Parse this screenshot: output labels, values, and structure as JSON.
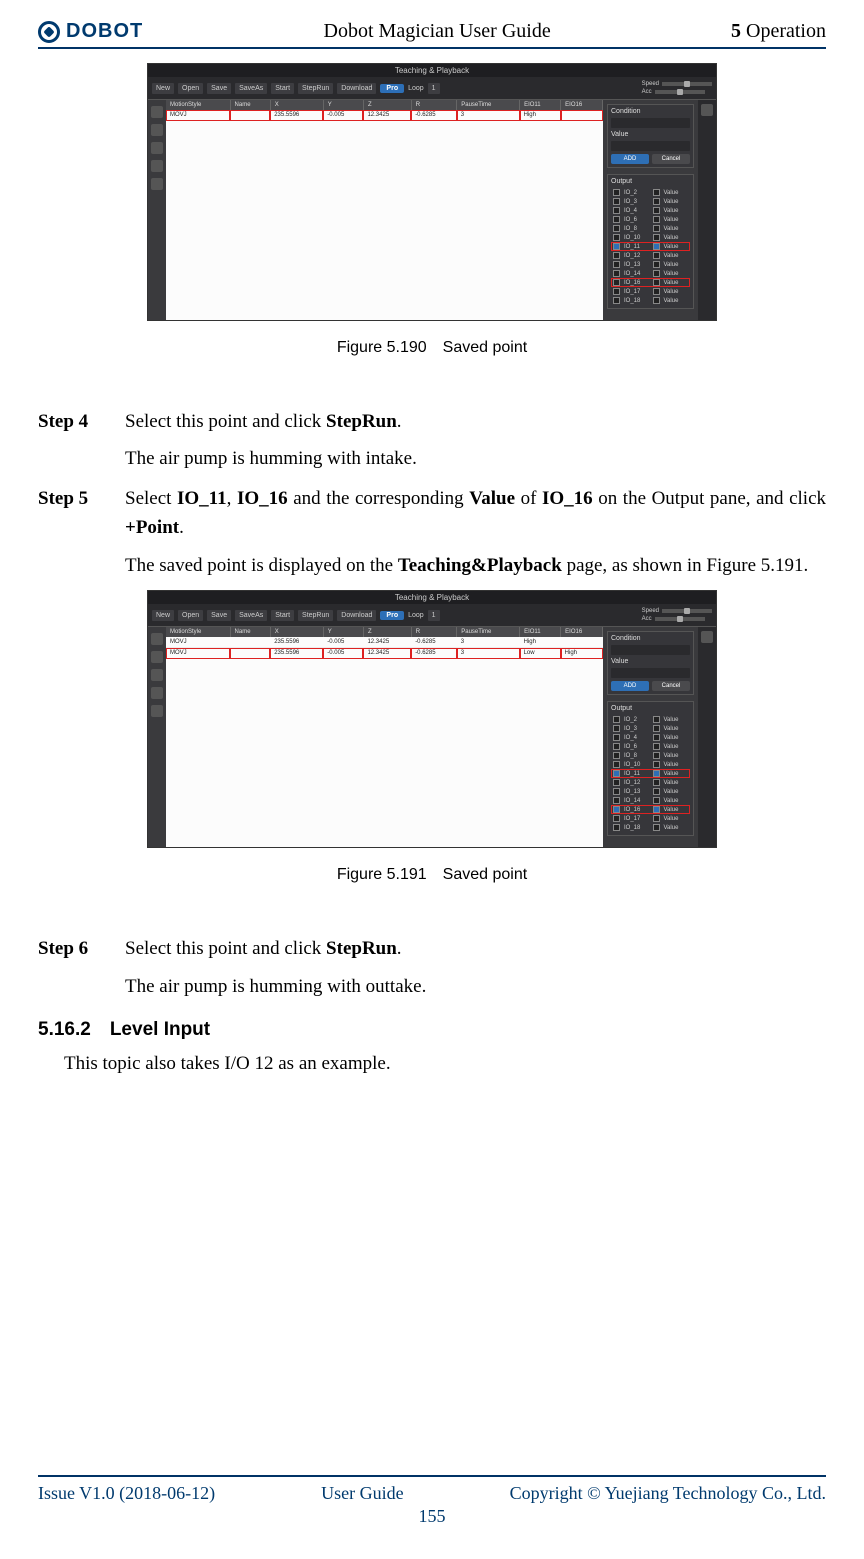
{
  "header": {
    "logo_text": "DOBOT",
    "center": "Dobot Magician User Guide",
    "right_section_num": "5",
    "right_section": " Operation"
  },
  "screenshot": {
    "title": "Teaching & Playback",
    "toolbar": [
      "New",
      "Open",
      "Save",
      "SaveAs",
      "Start",
      "StepRun",
      "Download"
    ],
    "pro": "Pro",
    "loop_label": "Loop",
    "loop_val": "1",
    "speed_label": "Speed",
    "acc_label": "Acc",
    "table_headers": [
      "MotionStyle",
      "Name",
      "X",
      "Y",
      "Z",
      "R",
      "PauseTime",
      "EIO11",
      "EIO16"
    ],
    "rows1": [
      [
        "MOVJ",
        "",
        "235.5596",
        "-0.005",
        "12.3425",
        "-0.6285",
        "3",
        "High",
        ""
      ]
    ],
    "rows2": [
      [
        "MOVJ",
        "",
        "235.5596",
        "-0.005",
        "12.3425",
        "-0.6285",
        "3",
        "High",
        ""
      ],
      [
        "MOVJ",
        "",
        "235.5596",
        "-0.005",
        "12.3425",
        "-0.6285",
        "3",
        "Low",
        "High"
      ]
    ],
    "right_panel": {
      "condition": "Condition",
      "value": "Value",
      "add": "ADD",
      "cancel": "Cancel",
      "output": "Output",
      "ios": [
        "IO_2",
        "IO_3",
        "IO_4",
        "IO_6",
        "IO_8",
        "IO_10",
        "IO_11",
        "IO_12",
        "IO_13",
        "IO_14",
        "IO_16",
        "IO_17",
        "IO_18"
      ],
      "val": "Value"
    }
  },
  "figcap1": "Figure 5.190 Saved point",
  "figcap2": "Figure 5.191 Saved point",
  "step4_label": "Step 4",
  "step4_body_pre": "Select this point and click ",
  "step4_body_b": "StepRun",
  "step4_body_post": ".",
  "step4_follow": "The air pump is humming with intake.",
  "step5_label": "Step 5",
  "step5_pre": "Select ",
  "step5_b1": "IO_11",
  "step5_mid1": ", ",
  "step5_b2": "IO_16",
  "step5_mid2": " and the corresponding ",
  "step5_b3": "Value",
  "step5_mid3": " of ",
  "step5_b4": "IO_16",
  "step5_mid4": " on the Output pane, and click ",
  "step5_b5": "+Point",
  "step5_post": ".",
  "step5_follow_pre": "The saved point is displayed on the ",
  "step5_follow_b": "Teaching&Playback",
  "step5_follow_post": " page, as shown in Figure 5.191.",
  "step6_label": "Step 6",
  "step6_pre": "Select this point and click ",
  "step6_b": "StepRun",
  "step6_post": ".",
  "step6_follow": "The air pump is humming with outtake.",
  "section_num": "5.16.2 ",
  "section_title": "Level Input",
  "section_body": "This topic also takes I/O 12 as an example.",
  "footer": {
    "left": "Issue V1.0 (2018-06-12)",
    "center": "User Guide",
    "right": "Copyright © Yuejiang Technology Co., Ltd.",
    "page": "155"
  }
}
